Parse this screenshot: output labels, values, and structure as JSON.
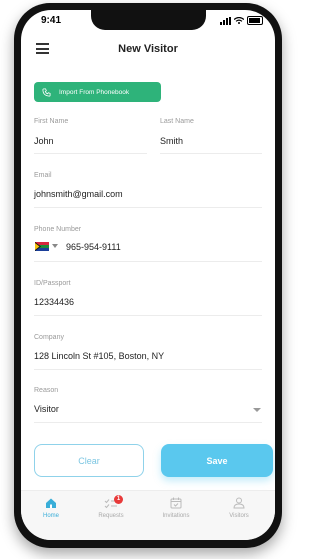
{
  "status": {
    "time": "9:41"
  },
  "header": {
    "title": "New Visitor"
  },
  "import_button": {
    "label": "Import From Phonebook"
  },
  "form": {
    "first_name": {
      "label": "First Name",
      "value": "John"
    },
    "last_name": {
      "label": "Last Name",
      "value": "Smith"
    },
    "email": {
      "label": "Email",
      "value": "johnsmith@gmail.com"
    },
    "phone": {
      "label": "Phone Number",
      "value": "965-954-9111"
    },
    "id_passport": {
      "label": "ID/Passport",
      "value": "12334436"
    },
    "company": {
      "label": "Company",
      "value": "128 Lincoln St #105, Boston, NY"
    },
    "reason": {
      "label": "Reason",
      "value": "Visitor"
    }
  },
  "actions": {
    "clear_label": "Clear",
    "save_label": "Save"
  },
  "tabs": [
    {
      "label": "Home",
      "icon": "home-icon",
      "active": true
    },
    {
      "label": "Requests",
      "icon": "requests-icon",
      "badge": "1"
    },
    {
      "label": "Invitations",
      "icon": "calendar-icon"
    },
    {
      "label": "Visitors",
      "icon": "user-icon"
    }
  ],
  "colors": {
    "accent_green": "#2eb37a",
    "accent_blue": "#5ac8ee",
    "badge_red": "#e83a3a"
  }
}
